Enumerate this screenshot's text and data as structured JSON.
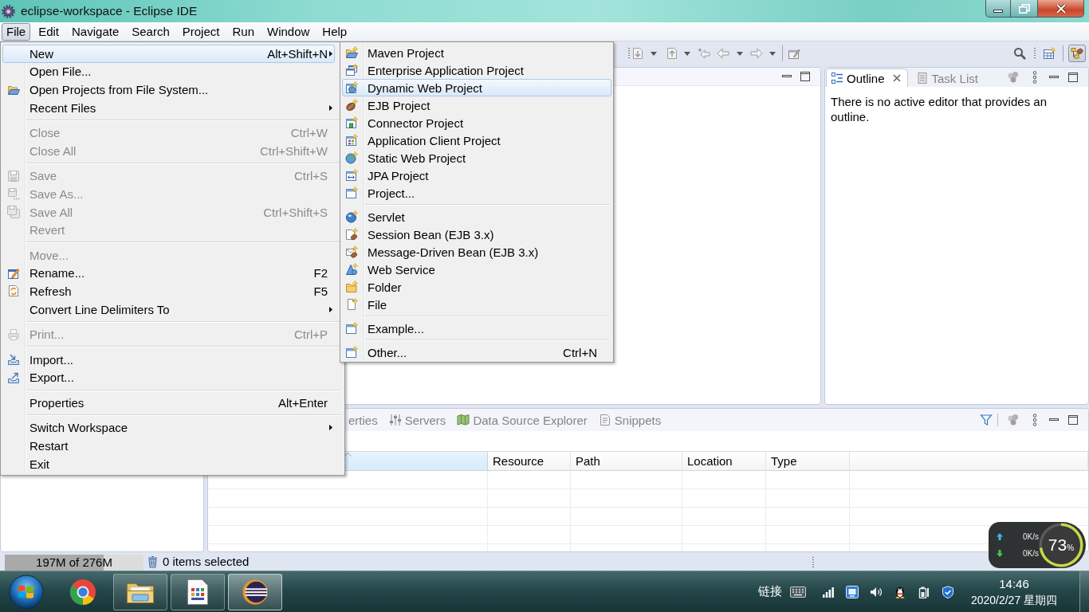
{
  "window": {
    "title": "eclipse-workspace - Eclipse IDE"
  },
  "menu_bar": [
    {
      "label": "File",
      "selected": true
    },
    {
      "label": "Edit",
      "selected": false
    },
    {
      "label": "Navigate",
      "selected": false
    },
    {
      "label": "Search",
      "selected": false
    },
    {
      "label": "Project",
      "selected": false
    },
    {
      "label": "Run",
      "selected": false
    },
    {
      "label": "Window",
      "selected": false
    },
    {
      "label": "Help",
      "selected": false
    }
  ],
  "toolbar": {
    "perspectives": [
      {
        "selected": false
      },
      {
        "selected": true
      }
    ]
  },
  "file_menu": {
    "groups": [
      [
        {
          "label": "New",
          "shortcut": "Alt+Shift+N",
          "submenu": true,
          "selected": true,
          "disabled": false
        },
        {
          "label": "Open File...",
          "submenu": false,
          "selected": false,
          "disabled": false
        },
        {
          "label": "Open Projects from File System...",
          "submenu": false,
          "selected": false,
          "disabled": false
        },
        {
          "label": "Recent Files",
          "submenu": true,
          "selected": false,
          "disabled": false
        }
      ],
      [
        {
          "label": "Close",
          "shortcut": "Ctrl+W",
          "submenu": false,
          "selected": false,
          "disabled": true
        },
        {
          "label": "Close All",
          "shortcut": "Ctrl+Shift+W",
          "submenu": false,
          "selected": false,
          "disabled": true
        }
      ],
      [
        {
          "label": "Save",
          "shortcut": "Ctrl+S",
          "submenu": false,
          "selected": false,
          "disabled": true
        },
        {
          "label": "Save As...",
          "submenu": false,
          "selected": false,
          "disabled": true
        },
        {
          "label": "Save All",
          "shortcut": "Ctrl+Shift+S",
          "submenu": false,
          "selected": false,
          "disabled": true
        },
        {
          "label": "Revert",
          "submenu": false,
          "selected": false,
          "disabled": true
        }
      ],
      [
        {
          "label": "Move...",
          "submenu": false,
          "selected": false,
          "disabled": true
        },
        {
          "label": "Rename...",
          "shortcut": "F2",
          "submenu": false,
          "selected": false,
          "disabled": false
        },
        {
          "label": "Refresh",
          "shortcut": "F5",
          "submenu": false,
          "selected": false,
          "disabled": false
        },
        {
          "label": "Convert Line Delimiters To",
          "submenu": true,
          "selected": false,
          "disabled": false
        }
      ],
      [
        {
          "label": "Print...",
          "shortcut": "Ctrl+P",
          "submenu": false,
          "selected": false,
          "disabled": true
        }
      ],
      [
        {
          "label": "Import...",
          "submenu": false,
          "selected": false,
          "disabled": false
        },
        {
          "label": "Export...",
          "submenu": false,
          "selected": false,
          "disabled": false
        }
      ],
      [
        {
          "label": "Properties",
          "shortcut": "Alt+Enter",
          "submenu": false,
          "selected": false,
          "disabled": false
        }
      ],
      [
        {
          "label": "Switch Workspace",
          "submenu": true,
          "selected": false,
          "disabled": false
        },
        {
          "label": "Restart",
          "submenu": false,
          "selected": false,
          "disabled": false
        },
        {
          "label": "Exit",
          "submenu": false,
          "selected": false,
          "disabled": false
        }
      ]
    ]
  },
  "new_submenu": {
    "groups": [
      [
        {
          "label": "Maven Project",
          "selected": false
        },
        {
          "label": "Enterprise Application Project",
          "selected": false
        },
        {
          "label": "Dynamic Web Project",
          "selected": true
        },
        {
          "label": "EJB Project",
          "selected": false
        },
        {
          "label": "Connector Project",
          "selected": false
        },
        {
          "label": "Application Client Project",
          "selected": false
        },
        {
          "label": "Static Web Project",
          "selected": false
        },
        {
          "label": "JPA Project",
          "selected": false
        },
        {
          "label": "Project...",
          "selected": false
        }
      ],
      [
        {
          "label": "Servlet",
          "selected": false
        },
        {
          "label": "Session Bean (EJB 3.x)",
          "selected": false
        },
        {
          "label": "Message-Driven Bean (EJB 3.x)",
          "selected": false
        },
        {
          "label": "Web Service",
          "selected": false
        },
        {
          "label": "Folder",
          "selected": false
        },
        {
          "label": "File",
          "selected": false
        }
      ],
      [
        {
          "label": "Example...",
          "selected": false
        }
      ],
      [
        {
          "label": "Other...",
          "shortcut": "Ctrl+N",
          "selected": false
        }
      ]
    ]
  },
  "outline_view": {
    "tabs": [
      {
        "label": "Outline",
        "selected": true
      },
      {
        "label": "Task List",
        "selected": false
      }
    ],
    "message": "There is no active editor that provides an outline."
  },
  "bottom_panel": {
    "tabs": [
      {
        "label": "erties",
        "selected": false
      },
      {
        "label": "Servers",
        "selected": false
      },
      {
        "label": "Data Source Explorer",
        "selected": false
      },
      {
        "label": "Snippets",
        "selected": false
      }
    ],
    "columns": [
      {
        "sorted": true
      },
      {
        "label": "Resource",
        "sorted": false
      },
      {
        "label": "Path",
        "sorted": false
      },
      {
        "label": "Location",
        "sorted": false
      },
      {
        "label": "Type",
        "sorted": false
      }
    ]
  },
  "status_bar": {
    "heap": {
      "text": "197M of 276M",
      "level": 0.71
    },
    "message": "0 items selected"
  },
  "net_monitor": {
    "upload": "0K/s",
    "download": "0K/s",
    "value": "73",
    "unit": "%",
    "chart_data": [
      {
        "type": "donut",
        "values": [
          73,
          27
        ],
        "colors": [
          "#c8d84a",
          "#5a5a5a"
        ]
      }
    ]
  },
  "taskbar": {
    "apps": [
      {
        "open": false,
        "selected": false
      },
      {
        "open": true,
        "selected": false
      },
      {
        "open": true,
        "selected": false
      },
      {
        "open": true,
        "selected": true
      }
    ],
    "tray_label": "链接",
    "time": "14:46",
    "date": "2020/2/27 星期四"
  }
}
